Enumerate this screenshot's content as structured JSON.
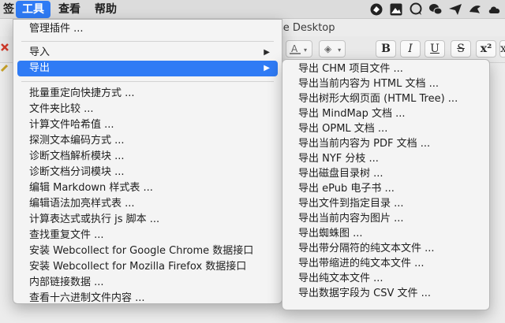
{
  "menubar": {
    "items": [
      {
        "label": "签"
      },
      {
        "label": "工具"
      },
      {
        "label": "查看"
      },
      {
        "label": "帮助"
      }
    ],
    "active_index": 1
  },
  "window": {
    "title_fragment": "se Desktop"
  },
  "toolbar": {
    "font_color_letter": "A",
    "buttons": [
      "B",
      "I",
      "U",
      "S",
      "x²",
      "x"
    ]
  },
  "tools_menu": {
    "items": [
      {
        "label": "管理插件 ...",
        "submenu": false
      },
      {
        "label": "导入",
        "submenu": true
      },
      {
        "label": "导出",
        "submenu": true,
        "highlighted": true
      },
      {
        "label": "批量重定向快捷方式 ...",
        "submenu": false
      },
      {
        "label": "文件夹比较 ...",
        "submenu": false
      },
      {
        "label": "计算文件哈希值 ...",
        "submenu": false
      },
      {
        "label": "探测文本编码方式 ...",
        "submenu": false
      },
      {
        "label": "诊断文档解析模块 ...",
        "submenu": false
      },
      {
        "label": "诊断文档分词模块 ...",
        "submenu": false
      },
      {
        "label": "编辑 Markdown 样式表 ...",
        "submenu": false
      },
      {
        "label": "编辑语法加亮样式表 ...",
        "submenu": false
      },
      {
        "label": "计算表达式或执行 js 脚本 ...",
        "submenu": false
      },
      {
        "label": "查找重复文件 ...",
        "submenu": false
      },
      {
        "label": "安装 Webcollect for Google Chrome 数据接口",
        "submenu": false
      },
      {
        "label": "安装 Webcollect for Mozilla Firefox 数据接口",
        "submenu": false
      },
      {
        "label": "内部链接数据 ...",
        "submenu": false
      },
      {
        "label": "查看十六进制文件内容 ...",
        "submenu": false
      }
    ]
  },
  "export_submenu": {
    "items": [
      {
        "label": "导出 CHM 项目文件 ..."
      },
      {
        "label": "导出当前内容为 HTML 文档 ..."
      },
      {
        "label": "导出树形大纲页面 (HTML Tree) ..."
      },
      {
        "label": "导出 MindMap 文档 ..."
      },
      {
        "label": "导出 OPML 文档 ..."
      },
      {
        "label": "导出当前内容为 PDF 文档 ..."
      },
      {
        "label": "导出 NYF 分枝 ..."
      },
      {
        "label": "导出磁盘目录树 ..."
      },
      {
        "label": "导出 ePub 电子书 ..."
      },
      {
        "label": "导出文件到指定目录 ..."
      },
      {
        "label": "导出当前内容为图片 ..."
      },
      {
        "label": "导出蜘蛛图 ..."
      },
      {
        "label": "导出带分隔符的纯文本文件 ..."
      },
      {
        "label": "导出带缩进的纯文本文件 ..."
      },
      {
        "label": "导出纯文本文件 ..."
      },
      {
        "label": "导出数据字段为 CSV 文件 ..."
      }
    ]
  },
  "status_icons": [
    {
      "icon": "tag-icon"
    },
    {
      "icon": "image-icon"
    },
    {
      "icon": "chat-bubble-icon"
    },
    {
      "icon": "wechat-icon"
    },
    {
      "icon": "paper-plane-icon"
    },
    {
      "icon": "bird-icon"
    },
    {
      "icon": "cloud-icon"
    }
  ],
  "colors": {
    "highlight": "#2f7bf5",
    "menu_bg": "#f4f4f4"
  }
}
